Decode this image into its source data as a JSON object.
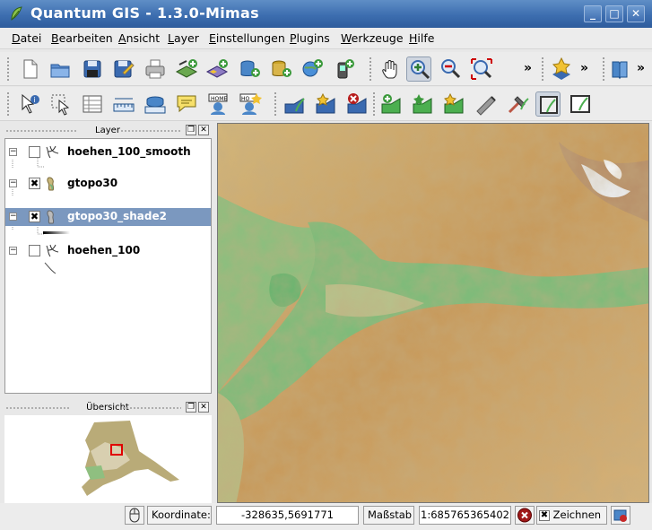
{
  "window": {
    "title": "Quantum GIS - 1.3.0-Mimas"
  },
  "menu": [
    "Datei",
    "Bearbeiten",
    "Ansicht",
    "Layer",
    "Einstellungen",
    "Plugins",
    "Werkzeuge",
    "Hilfe"
  ],
  "toolbar": {
    "overflow": "»"
  },
  "layer_panel": {
    "title": "Layer",
    "layers": [
      {
        "name": "hoehen_100_smooth",
        "visible": false,
        "selected": false
      },
      {
        "name": "gtopo30",
        "visible": true,
        "selected": false
      },
      {
        "name": "gtopo30_shade2",
        "visible": true,
        "selected": true
      },
      {
        "name": "hoehen_100",
        "visible": false,
        "selected": false
      }
    ]
  },
  "overview_panel": {
    "title": "Übersicht"
  },
  "statusbar": {
    "coord_label": "Koordinate:",
    "coord_value": "-328635,5691771",
    "scale_label": "Maßstab",
    "scale_value": "1:685765365402",
    "render_label": "Zeichnen",
    "render_checked": true
  },
  "colors": {
    "title_bar": "#3d6eb0",
    "selection": "#7b98bf",
    "lowland": "#78b878",
    "highland": "#c9a66e"
  }
}
